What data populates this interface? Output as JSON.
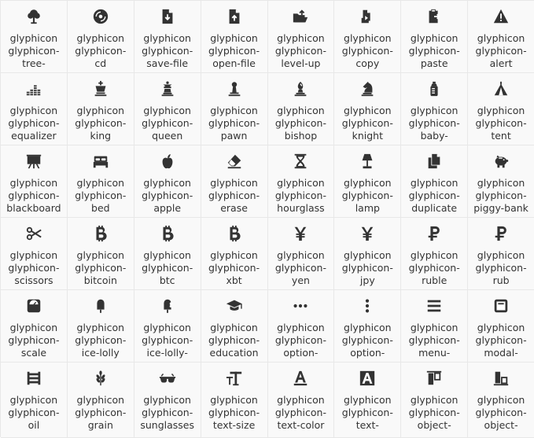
{
  "colors": {
    "text": "#333333",
    "icon": "#333333",
    "cell_bg": "#f9f9f9",
    "border": "#e8e8e8"
  },
  "icons": [
    {
      "name": "tree-deciduous-icon",
      "lines": [
        "glyphicon",
        "glyphicon-",
        "tree-"
      ]
    },
    {
      "name": "cd-icon",
      "lines": [
        "glyphicon",
        "glyphicon-",
        "cd"
      ]
    },
    {
      "name": "save-file-icon",
      "lines": [
        "glyphicon",
        "glyphicon-",
        "save-file"
      ]
    },
    {
      "name": "open-file-icon",
      "lines": [
        "glyphicon",
        "glyphicon-",
        "open-file"
      ]
    },
    {
      "name": "level-up-icon",
      "lines": [
        "glyphicon",
        "glyphicon-",
        "level-up"
      ]
    },
    {
      "name": "copy-icon",
      "lines": [
        "glyphicon",
        "glyphicon-",
        "copy"
      ]
    },
    {
      "name": "paste-icon",
      "lines": [
        "glyphicon",
        "glyphicon-",
        "paste"
      ]
    },
    {
      "name": "alert-icon",
      "lines": [
        "glyphicon",
        "glyphicon-",
        "alert"
      ]
    },
    {
      "name": "equalizer-icon",
      "lines": [
        "glyphicon",
        "glyphicon-",
        "equalizer"
      ]
    },
    {
      "name": "king-icon",
      "lines": [
        "glyphicon",
        "glyphicon-",
        "king"
      ]
    },
    {
      "name": "queen-icon",
      "lines": [
        "glyphicon",
        "glyphicon-",
        "queen"
      ]
    },
    {
      "name": "pawn-icon",
      "lines": [
        "glyphicon",
        "glyphicon-",
        "pawn"
      ]
    },
    {
      "name": "bishop-icon",
      "lines": [
        "glyphicon",
        "glyphicon-",
        "bishop"
      ]
    },
    {
      "name": "knight-icon",
      "lines": [
        "glyphicon",
        "glyphicon-",
        "knight"
      ]
    },
    {
      "name": "baby-formula-icon",
      "lines": [
        "glyphicon",
        "glyphicon-",
        "baby-"
      ]
    },
    {
      "name": "tent-icon",
      "lines": [
        "glyphicon",
        "glyphicon-",
        "tent"
      ]
    },
    {
      "name": "blackboard-icon",
      "lines": [
        "glyphicon",
        "glyphicon-",
        "blackboard"
      ]
    },
    {
      "name": "bed-icon",
      "lines": [
        "glyphicon",
        "glyphicon-",
        "bed"
      ]
    },
    {
      "name": "apple-icon",
      "lines": [
        "glyphicon",
        "glyphicon-",
        "apple"
      ]
    },
    {
      "name": "erase-icon",
      "lines": [
        "glyphicon",
        "glyphicon-",
        "erase"
      ]
    },
    {
      "name": "hourglass-icon",
      "lines": [
        "glyphicon",
        "glyphicon-",
        "hourglass"
      ]
    },
    {
      "name": "lamp-icon",
      "lines": [
        "glyphicon",
        "glyphicon-",
        "lamp"
      ]
    },
    {
      "name": "duplicate-icon",
      "lines": [
        "glyphicon",
        "glyphicon-",
        "duplicate"
      ]
    },
    {
      "name": "piggy-bank-icon",
      "lines": [
        "glyphicon",
        "glyphicon-",
        "piggy-bank"
      ]
    },
    {
      "name": "scissors-icon",
      "lines": [
        "glyphicon",
        "glyphicon-",
        "scissors"
      ]
    },
    {
      "name": "bitcoin-icon",
      "lines": [
        "glyphicon",
        "glyphicon-",
        "bitcoin"
      ]
    },
    {
      "name": "btc-icon",
      "lines": [
        "glyphicon",
        "glyphicon-",
        "btc"
      ]
    },
    {
      "name": "xbt-icon",
      "lines": [
        "glyphicon",
        "glyphicon-",
        "xbt"
      ]
    },
    {
      "name": "yen-icon",
      "lines": [
        "glyphicon",
        "glyphicon-",
        "yen"
      ]
    },
    {
      "name": "jpy-icon",
      "lines": [
        "glyphicon",
        "glyphicon-",
        "jpy"
      ]
    },
    {
      "name": "ruble-icon",
      "lines": [
        "glyphicon",
        "glyphicon-",
        "ruble"
      ]
    },
    {
      "name": "rub-icon",
      "lines": [
        "glyphicon",
        "glyphicon-",
        "rub"
      ]
    },
    {
      "name": "scale-icon",
      "lines": [
        "glyphicon",
        "glyphicon-",
        "scale"
      ]
    },
    {
      "name": "ice-lolly-icon",
      "lines": [
        "glyphicon",
        "glyphicon-",
        "ice-lolly"
      ]
    },
    {
      "name": "ice-lolly-tasted-icon",
      "lines": [
        "glyphicon",
        "glyphicon-",
        "ice-lolly-"
      ]
    },
    {
      "name": "education-icon",
      "lines": [
        "glyphicon",
        "glyphicon-",
        "education"
      ]
    },
    {
      "name": "option-horizontal-icon",
      "lines": [
        "glyphicon",
        "glyphicon-",
        "option-"
      ]
    },
    {
      "name": "option-vertical-icon",
      "lines": [
        "glyphicon",
        "glyphicon-",
        "option-"
      ]
    },
    {
      "name": "menu-hamburger-icon",
      "lines": [
        "glyphicon",
        "glyphicon-",
        "menu-"
      ]
    },
    {
      "name": "modal-window-icon",
      "lines": [
        "glyphicon",
        "glyphicon-",
        "modal-"
      ]
    },
    {
      "name": "oil-icon",
      "lines": [
        "glyphicon",
        "glyphicon-",
        "oil"
      ]
    },
    {
      "name": "grain-icon",
      "lines": [
        "glyphicon",
        "glyphicon-",
        "grain"
      ]
    },
    {
      "name": "sunglasses-icon",
      "lines": [
        "glyphicon",
        "glyphicon-",
        "sunglasses"
      ]
    },
    {
      "name": "text-size-icon",
      "lines": [
        "glyphicon",
        "glyphicon-",
        "text-size"
      ]
    },
    {
      "name": "text-color-icon",
      "lines": [
        "glyphicon",
        "glyphicon-",
        "text-color"
      ]
    },
    {
      "name": "text-background-icon",
      "lines": [
        "glyphicon",
        "glyphicon-",
        "text-"
      ]
    },
    {
      "name": "object-align-top-icon",
      "lines": [
        "glyphicon",
        "glyphicon-",
        "object-"
      ]
    },
    {
      "name": "object-align-bottom-icon",
      "lines": [
        "glyphicon",
        "glyphicon-",
        "object-"
      ]
    }
  ]
}
